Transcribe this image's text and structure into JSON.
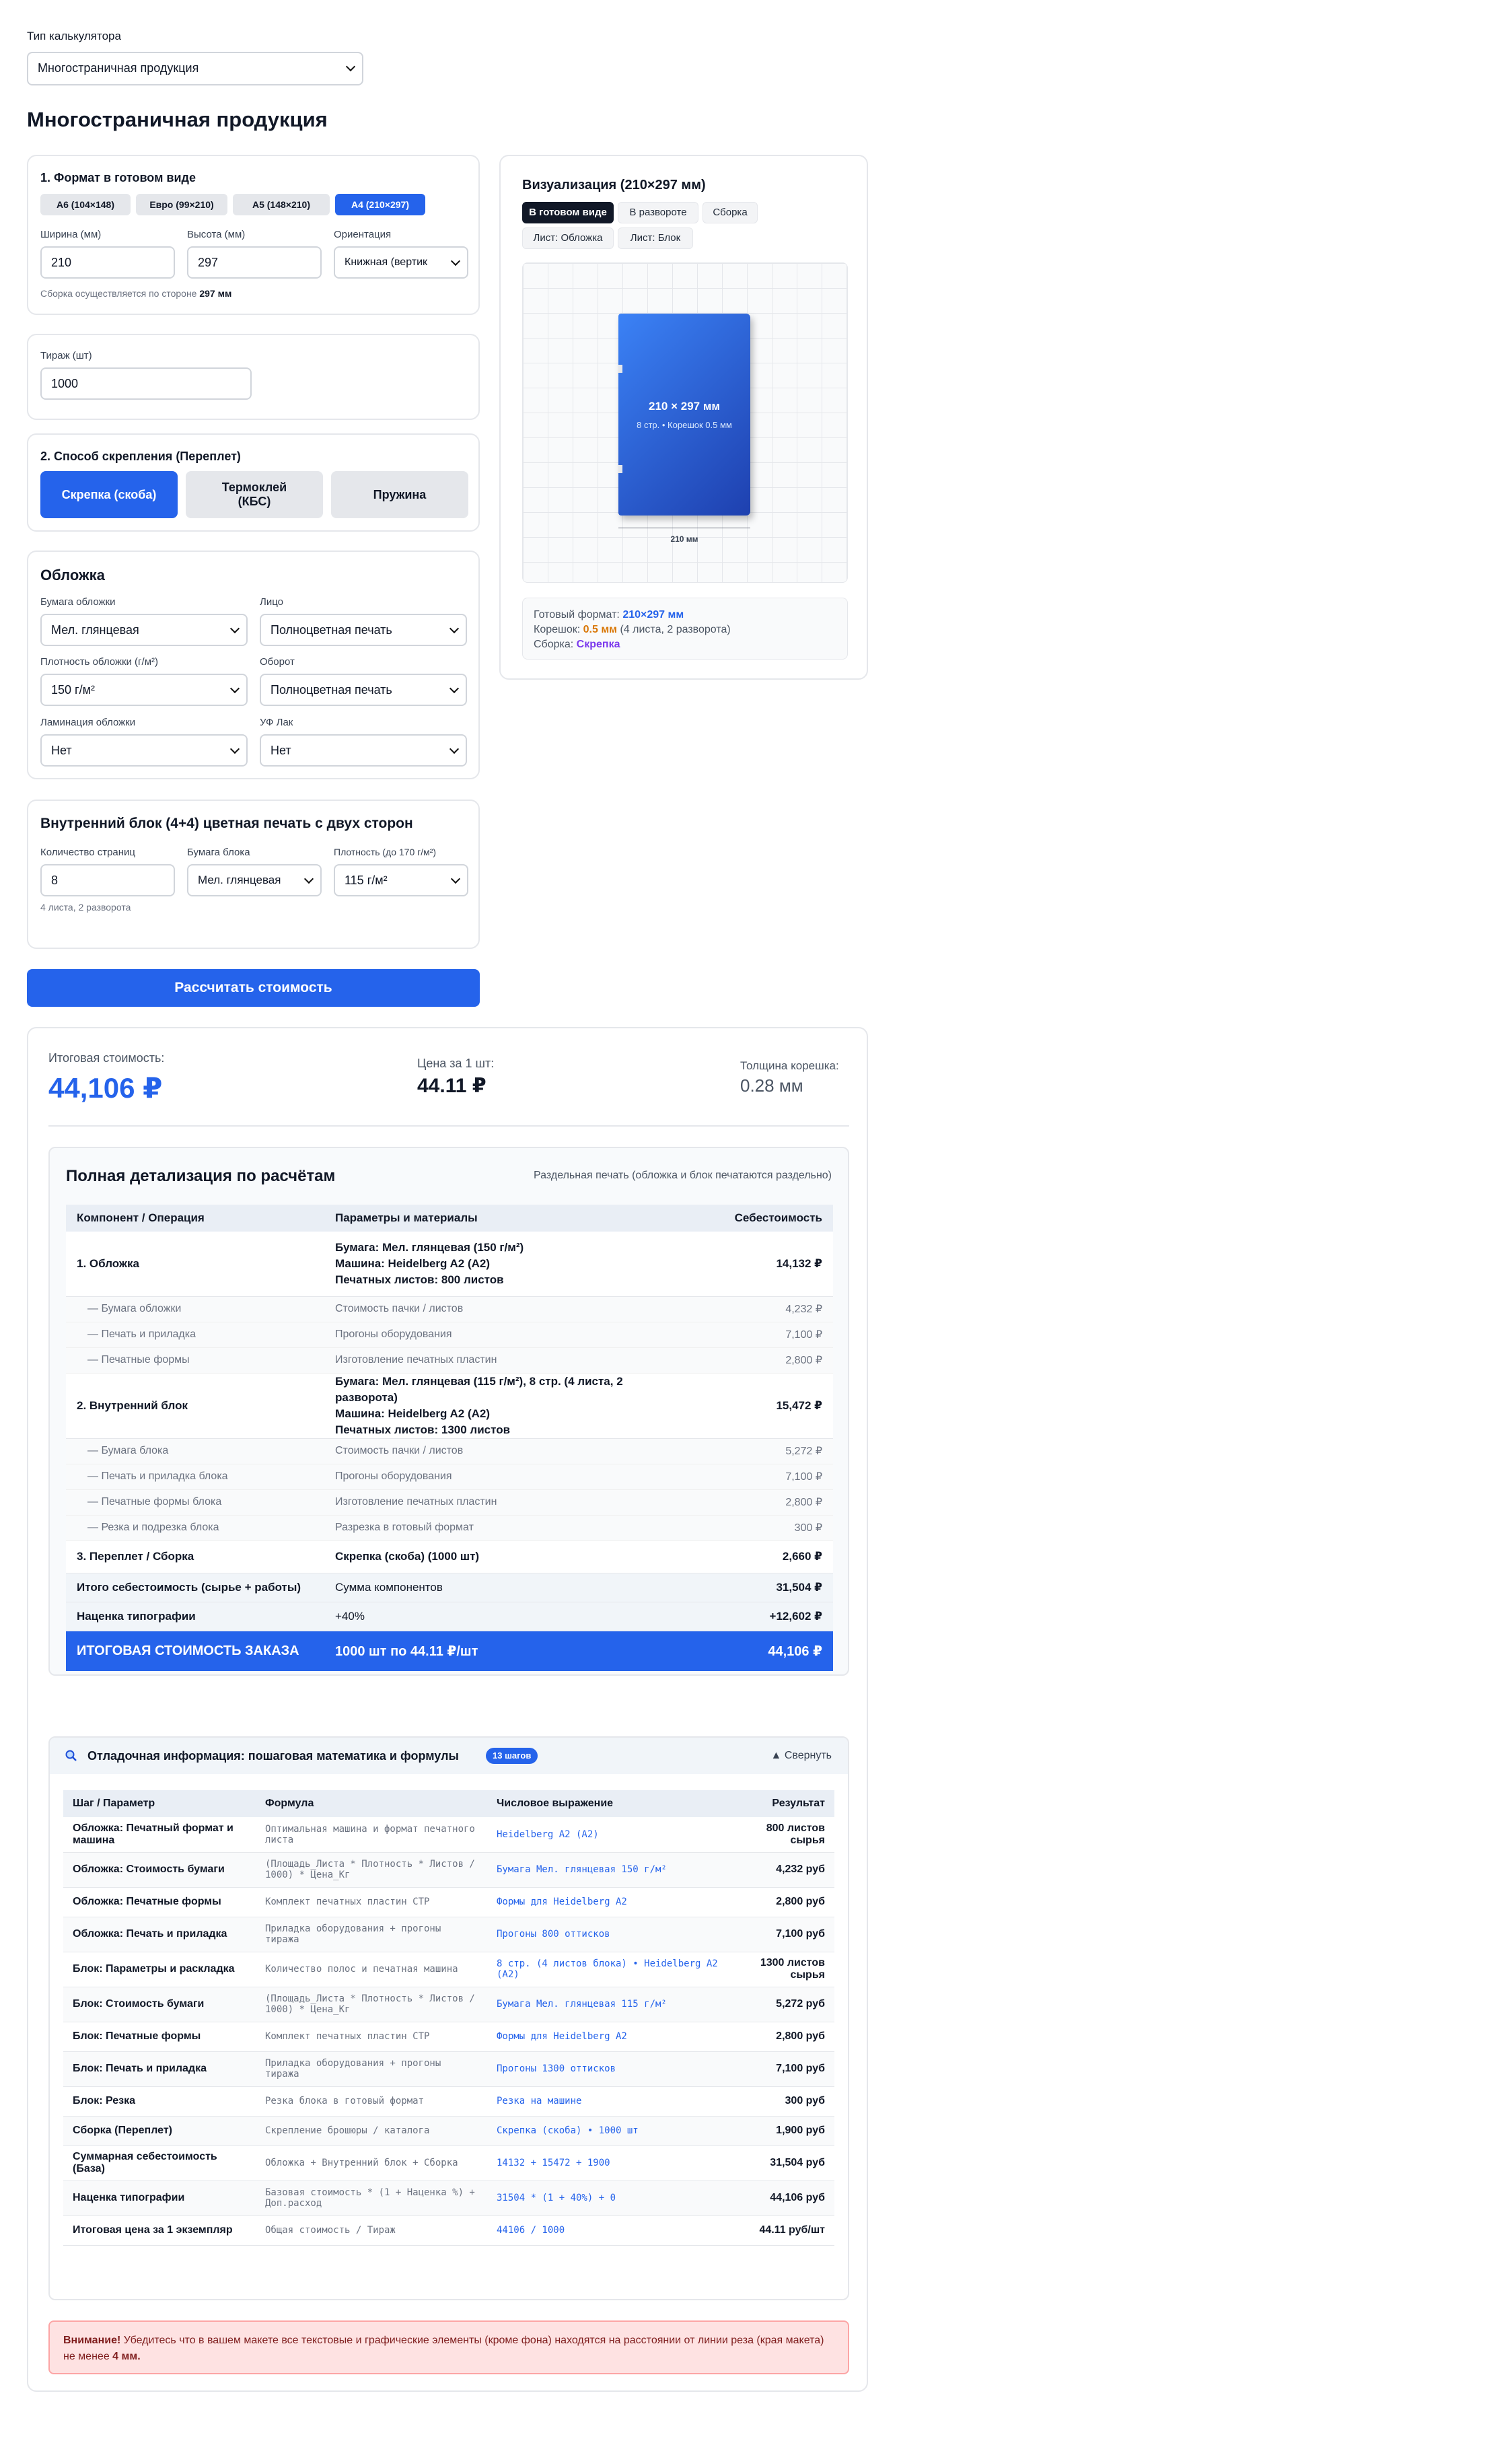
{
  "calc_type": {
    "label": "Тип калькулятора",
    "value": "Многостраничная продукция"
  },
  "page_title": "Многостраничная продукция",
  "format": {
    "title": "1. Формат в готовом виде",
    "presets": [
      "А6 (104×148)",
      "Евро (99×210)",
      "А5 (148×210)",
      "А4 (210×297)"
    ],
    "width_label": "Ширина (мм)",
    "width": "210",
    "height_label": "Высота (мм)",
    "height": "297",
    "orientation_label": "Ориентация",
    "orientation": "Книжная (вертик",
    "note_prefix": "Сборка осуществляется по стороне",
    "note_value": "297 мм"
  },
  "run": {
    "label": "Тираж (шт)",
    "value": "1000"
  },
  "binding": {
    "title": "2. Способ скрепления (Переплет)",
    "options": [
      "Скрепка (скоба)",
      "Термоклей (КБС)",
      "Пружина"
    ]
  },
  "cover": {
    "title": "Обложка",
    "paper_label": "Бумага обложки",
    "paper": "Мел. глянцевая",
    "face_label": "Лицо",
    "face": "Полноцветная печать",
    "density_label": "Плотность обложки (г/м²)",
    "density": "150 г/м²",
    "back_label": "Оборот",
    "back": "Полноцветная печать",
    "lam_label": "Ламинация обложки",
    "lam": "Нет",
    "uv_label": "УФ Лак",
    "uv": "Нет"
  },
  "block": {
    "title": "Внутренний блок (4+4) цветная печать с двух сторон",
    "pages_label": "Количество страниц",
    "pages": "8",
    "paper_label": "Бумага блока",
    "paper": "Мел. глянцевая",
    "density_label": "Плотность (до 170 г/м²)",
    "density": "115 г/м²",
    "note": "4 листа, 2 разворота"
  },
  "calc_button": "Рассчитать стоимость",
  "viz": {
    "title": "Визуализация (210×297 мм)",
    "tabs": [
      "В готовом виде",
      "В развороте",
      "Сборка",
      "Лист: Обложка",
      "Лист: Блок"
    ],
    "book_size": "210 × 297 мм",
    "book_sub": "8 стр. • Корешок 0.5 мм",
    "dim_label": "210 мм",
    "info1_label": "Готовый формат:",
    "info1_value": "210×297 мм",
    "info2_label": "Корешок:",
    "info2_value": "0.5 мм",
    "info2_extra": "(4 листа, 2 разворота)",
    "info3_label": "Сборка:",
    "info3_value": "Скрепка"
  },
  "summary": {
    "total_label": "Итоговая стоимость:",
    "total": "44,106 ₽",
    "unit_label": "Цена за 1 шт:",
    "unit": "44.11 ₽",
    "spine_label": "Толщина корешка:",
    "spine": "0.28 мм"
  },
  "detail": {
    "title": "Полная детализация по расчётам",
    "note": "Раздельная печать (обложка и блок печатаются раздельно)",
    "headers": [
      "Компонент / Операция",
      "Параметры и материалы",
      "Себестоимость"
    ],
    "cover_row": {
      "name": "1. Обложка",
      "p1": "Бумага: Мел. глянцевая (150 г/м²)",
      "p2": "Машина: Heidelberg A2 (A2)",
      "p3": "Печатных листов: 800 листов",
      "cost": "14,132 ₽"
    },
    "cover_sub": [
      {
        "name": "— Бумага обложки",
        "param": "Стоимость пачки / листов",
        "cost": "4,232 ₽"
      },
      {
        "name": "— Печать и приладка",
        "param": "Прогоны оборудования",
        "cost": "7,100 ₽"
      },
      {
        "name": "— Печатные формы",
        "param": "Изготовление печатных пластин",
        "cost": "2,800 ₽"
      }
    ],
    "block_row": {
      "name": "2. Внутренний блок",
      "p1": "Бумага: Мел. глянцевая (115 г/м²), 8 стр. (4 листа, 2 разворота)",
      "p2": "Машина: Heidelberg A2 (A2)",
      "p3": "Печатных листов: 1300 листов",
      "cost": "15,472 ₽"
    },
    "block_sub": [
      {
        "name": "— Бумага блока",
        "param": "Стоимость пачки / листов",
        "cost": "5,272 ₽"
      },
      {
        "name": "— Печать и приладка блока",
        "param": "Прогоны оборудования",
        "cost": "7,100 ₽"
      },
      {
        "name": "— Печатные формы блока",
        "param": "Изготовление печатных пластин",
        "cost": "2,800 ₽"
      },
      {
        "name": "— Резка и подрезка блока",
        "param": "Разрезка в готовый формат",
        "cost": "300 ₽"
      }
    ],
    "bind_row": {
      "name": "3. Переплет / Сборка",
      "param": "Скрепка (скоба) (1000 шт)",
      "cost": "2,660 ₽"
    },
    "total_row": {
      "name": "Итого себестоимость (сырье + работы)",
      "param": "Сумма компонентов",
      "cost": "31,504 ₽"
    },
    "markup_row": {
      "name": "Наценка типографии",
      "param": "+40%",
      "cost": "+12,602 ₽"
    },
    "final_row": {
      "name": "ИТОГОВАЯ СТОИМОСТЬ ЗАКАЗА",
      "param": "1000 шт по 44.11 ₽/шт",
      "cost": "44,106 ₽"
    }
  },
  "debug": {
    "title": "Отладочная информация: пошаговая математика и формулы",
    "badge": "13 шагов",
    "collapse": "Свернуть",
    "headers": [
      "Шаг / Параметр",
      "Формула",
      "Числовое выражение",
      "Результат"
    ],
    "rows": [
      {
        "step": "Обложка: Печатный формат и машина",
        "formula": "Оптимальная машина и формат печатного листа",
        "expr": "Heidelberg A2 (A2)",
        "result": "800 листов сырья"
      },
      {
        "step": "Обложка: Стоимость бумаги",
        "formula": "(Площадь_Листа * Плотность * Листов / 1000) * Цена_Кг",
        "expr": "Бумага Мел. глянцевая 150 г/м²",
        "result": "4,232 руб"
      },
      {
        "step": "Обложка: Печатные формы",
        "formula": "Комплект печатных пластин CTP",
        "expr": "Формы для Heidelberg A2",
        "result": "2,800 руб"
      },
      {
        "step": "Обложка: Печать и приладка",
        "formula": "Приладка оборудования + прогоны тиража",
        "expr": "Прогоны 800 оттисков",
        "result": "7,100 руб"
      },
      {
        "step": "Блок: Параметры и раскладка",
        "formula": "Количество полос и печатная машина",
        "expr": "8 стр. (4 листов блока) • Heidelberg A2 (A2)",
        "result": "1300 листов сырья"
      },
      {
        "step": "Блок: Стоимость бумаги",
        "formula": "(Площадь_Листа * Плотность * Листов / 1000) * Цена_Кг",
        "expr": "Бумага Мел. глянцевая 115 г/м²",
        "result": "5,272 руб"
      },
      {
        "step": "Блок: Печатные формы",
        "formula": "Комплект печатных пластин CTP",
        "expr": "Формы для Heidelberg A2",
        "result": "2,800 руб"
      },
      {
        "step": "Блок: Печать и приладка",
        "formula": "Приладка оборудования + прогоны тиража",
        "expr": "Прогоны 1300 оттисков",
        "result": "7,100 руб"
      },
      {
        "step": "Блок: Резка",
        "formula": "Резка блока в готовый формат",
        "expr": "Резка на машине",
        "result": "300 руб"
      },
      {
        "step": "Сборка (Переплет)",
        "formula": "Скрепление брошюры / каталога",
        "expr": "Скрепка (скоба) • 1000 шт",
        "result": "1,900 руб"
      },
      {
        "step": "Суммарная себестоимость (База)",
        "formula": "Обложка + Внутренний блок + Сборка",
        "expr": "14132 + 15472 + 1900",
        "result": "31,504 руб"
      },
      {
        "step": "Наценка типографии",
        "formula": "Базовая стоимость * (1 + Наценка %) + Доп.расход",
        "expr": "31504 * (1 + 40%) + 0",
        "result": "44,106 руб"
      },
      {
        "step": "Итоговая цена за 1 экземпляр",
        "formula": "Общая стоимость / Тираж",
        "expr": "44106 / 1000",
        "result": "44.11 руб/шт"
      }
    ]
  },
  "warning": {
    "bold": "Внимание!",
    "text": "Убедитесь что в вашем макете все текстовые и графические элементы (кроме фона) находятся на расстоянии от линии реза (края макета) не менее",
    "bold2": "4 мм."
  },
  "colors": {
    "primary": "#2563eb",
    "dark": "#111827",
    "warning_bg": "#fee2e2",
    "warning_border": "#fca5a5",
    "orange": "#d97706",
    "purple": "#7c3aed"
  }
}
